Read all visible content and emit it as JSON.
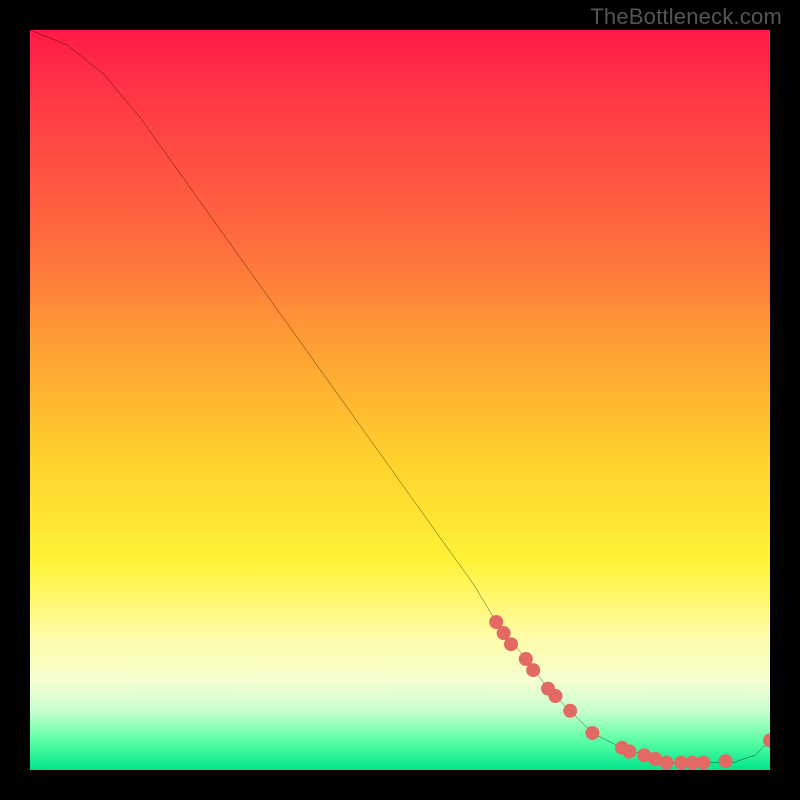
{
  "attribution": "TheBottleneck.com",
  "chart_data": {
    "type": "line",
    "title": "",
    "xlabel": "",
    "ylabel": "",
    "xlim": [
      0,
      100
    ],
    "ylim": [
      0,
      100
    ],
    "grid": false,
    "legend": false,
    "series": [
      {
        "name": "curve",
        "color": "#000000",
        "x": [
          0,
          5,
          10,
          15,
          20,
          25,
          30,
          35,
          40,
          45,
          50,
          55,
          60,
          63,
          67,
          70,
          73,
          76,
          80,
          83,
          86,
          89,
          92,
          95,
          98,
          100
        ],
        "y": [
          100,
          98,
          94,
          88,
          81,
          74,
          67,
          60,
          53,
          46,
          39,
          32,
          25,
          20,
          15,
          11,
          8,
          5,
          3,
          2,
          1,
          1,
          1,
          1,
          2,
          4
        ]
      }
    ],
    "markers": [
      {
        "x": 63,
        "y": 20
      },
      {
        "x": 64,
        "y": 18.5
      },
      {
        "x": 65,
        "y": 17
      },
      {
        "x": 67,
        "y": 15
      },
      {
        "x": 68,
        "y": 13.5
      },
      {
        "x": 70,
        "y": 11
      },
      {
        "x": 71,
        "y": 10
      },
      {
        "x": 73,
        "y": 8
      },
      {
        "x": 76,
        "y": 5
      },
      {
        "x": 80,
        "y": 3
      },
      {
        "x": 81,
        "y": 2.5
      },
      {
        "x": 83,
        "y": 2
      },
      {
        "x": 84.5,
        "y": 1.5
      },
      {
        "x": 86,
        "y": 1
      },
      {
        "x": 88,
        "y": 1
      },
      {
        "x": 89.5,
        "y": 1
      },
      {
        "x": 91,
        "y": 1
      },
      {
        "x": 94,
        "y": 1.2
      },
      {
        "x": 100,
        "y": 4
      }
    ],
    "marker_style": {
      "color": "#e26a63",
      "radius_px": 7
    }
  }
}
